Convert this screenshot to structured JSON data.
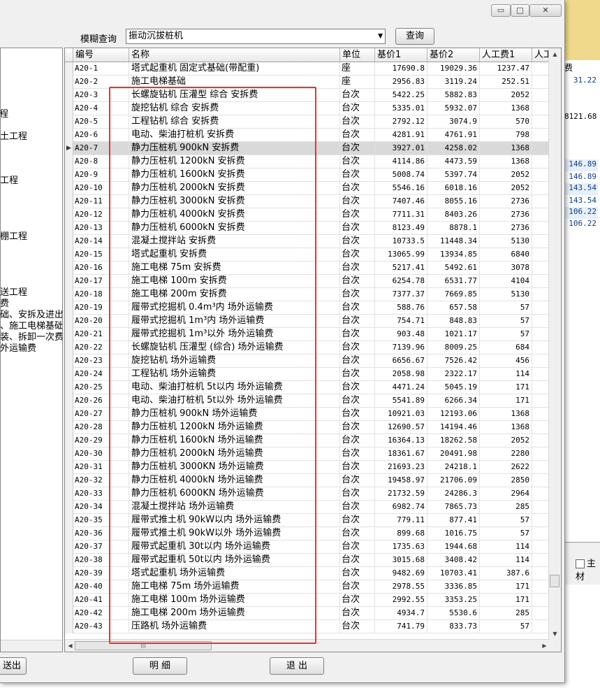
{
  "window": {
    "minimize_glyph": "▭",
    "maximize_glyph": "□",
    "close_glyph": "✕"
  },
  "search": {
    "label": "模糊查询",
    "value": "振动沉拔桩机",
    "dropdown_glyph": "▼",
    "query_button": "查询"
  },
  "left_tree": [
    "程",
    "土工程",
    "工程",
    "棚工程",
    "送工程",
    "费",
    "础、安拆及进出",
    "、施工电梯基础",
    "装、拆卸一次费",
    "外运输费"
  ],
  "table": {
    "headers": [
      "编号",
      "名称",
      "单位",
      "基价1",
      "基价2",
      "人工费1",
      "人工"
    ],
    "selected_marker": "▶",
    "rows": [
      {
        "code": "A20-1",
        "name": "塔式起重机 固定式基础(带配重)",
        "unit": "座",
        "p1": "17690.8",
        "p2": "19029.36",
        "lab": "1237.47"
      },
      {
        "code": "A20-2",
        "name": "施工电梯基础",
        "unit": "座",
        "p1": "2956.83",
        "p2": "3119.24",
        "lab": "252.51"
      },
      {
        "code": "A20-3",
        "name": "长螺旋钻机 压灌型 综合 安拆费",
        "unit": "台次",
        "p1": "5422.25",
        "p2": "5882.83",
        "lab": "2052"
      },
      {
        "code": "A20-4",
        "name": "旋挖钻机 综合 安拆费",
        "unit": "台次",
        "p1": "5335.01",
        "p2": "5932.07",
        "lab": "1368"
      },
      {
        "code": "A20-5",
        "name": "工程钻机 综合 安拆费",
        "unit": "台次",
        "p1": "2792.12",
        "p2": "3074.9",
        "lab": "570"
      },
      {
        "code": "A20-6",
        "name": "电动、柴油打桩机 安拆费",
        "unit": "台次",
        "p1": "4281.91",
        "p2": "4761.91",
        "lab": "798"
      },
      {
        "code": "A20-7",
        "name": "静力压桩机 900kN 安拆费",
        "unit": "台次",
        "p1": "3927.01",
        "p2": "4258.02",
        "lab": "1368"
      },
      {
        "code": "A20-8",
        "name": "静力压桩机 1200kN 安拆费",
        "unit": "台次",
        "p1": "4114.86",
        "p2": "4473.59",
        "lab": "1368"
      },
      {
        "code": "A20-9",
        "name": "静力压桩机 1600kN 安拆费",
        "unit": "台次",
        "p1": "5008.74",
        "p2": "5397.74",
        "lab": "2052"
      },
      {
        "code": "A20-10",
        "name": "静力压桩机 2000kN 安拆费",
        "unit": "台次",
        "p1": "5546.16",
        "p2": "6018.16",
        "lab": "2052"
      },
      {
        "code": "A20-11",
        "name": "静力压桩机 3000kN 安拆费",
        "unit": "台次",
        "p1": "7407.46",
        "p2": "8055.16",
        "lab": "2736"
      },
      {
        "code": "A20-12",
        "name": "静力压桩机 4000kN 安拆费",
        "unit": "台次",
        "p1": "7711.31",
        "p2": "8403.26",
        "lab": "2736"
      },
      {
        "code": "A20-13",
        "name": "静力压桩机 6000kN 安拆费",
        "unit": "台次",
        "p1": "8123.49",
        "p2": "8878.1",
        "lab": "2736"
      },
      {
        "code": "A20-14",
        "name": "混凝土搅拌站 安拆费",
        "unit": "台次",
        "p1": "10733.5",
        "p2": "11448.34",
        "lab": "5130"
      },
      {
        "code": "A20-15",
        "name": "塔式起重机 安拆费",
        "unit": "台次",
        "p1": "13065.99",
        "p2": "13934.85",
        "lab": "6840"
      },
      {
        "code": "A20-16",
        "name": "施工电梯 75m 安拆费",
        "unit": "台次",
        "p1": "5217.41",
        "p2": "5492.61",
        "lab": "3078"
      },
      {
        "code": "A20-17",
        "name": "施工电梯 100m 安拆费",
        "unit": "台次",
        "p1": "6254.78",
        "p2": "6531.77",
        "lab": "4104"
      },
      {
        "code": "A20-18",
        "name": "施工电梯 200m 安拆费",
        "unit": "台次",
        "p1": "7377.37",
        "p2": "7669.85",
        "lab": "5130"
      },
      {
        "code": "A20-19",
        "name": "履带式挖掘机 0.4m³内 场外运输费",
        "unit": "台次",
        "p1": "588.76",
        "p2": "657.58",
        "lab": "57"
      },
      {
        "code": "A20-20",
        "name": "履带式挖掘机 1m³内 场外运输费",
        "unit": "台次",
        "p1": "754.71",
        "p2": "848.83",
        "lab": "57"
      },
      {
        "code": "A20-21",
        "name": "履带式挖掘机 1m³以外 场外运输费",
        "unit": "台次",
        "p1": "903.48",
        "p2": "1021.17",
        "lab": "57"
      },
      {
        "code": "A20-22",
        "name": "长螺旋钻机 压灌型 (综合) 场外运输费",
        "unit": "台次",
        "p1": "7139.96",
        "p2": "8009.25",
        "lab": "684"
      },
      {
        "code": "A20-23",
        "name": "旋挖钻机 场外运输费",
        "unit": "台次",
        "p1": "6656.67",
        "p2": "7526.42",
        "lab": "456"
      },
      {
        "code": "A20-24",
        "name": "工程钻机 场外运输费",
        "unit": "台次",
        "p1": "2058.98",
        "p2": "2322.17",
        "lab": "114"
      },
      {
        "code": "A20-25",
        "name": "电动、柴油打桩机 5t以内 场外运输费",
        "unit": "台次",
        "p1": "4471.24",
        "p2": "5045.19",
        "lab": "171"
      },
      {
        "code": "A20-26",
        "name": "电动、柴油打桩机 5t以外 场外运输费",
        "unit": "台次",
        "p1": "5541.89",
        "p2": "6266.34",
        "lab": "171"
      },
      {
        "code": "A20-27",
        "name": "静力压桩机 900kN 场外运输费",
        "unit": "台次",
        "p1": "10921.03",
        "p2": "12193.06",
        "lab": "1368"
      },
      {
        "code": "A20-28",
        "name": "静力压桩机 1200kN 场外运输费",
        "unit": "台次",
        "p1": "12690.57",
        "p2": "14194.46",
        "lab": "1368"
      },
      {
        "code": "A20-29",
        "name": "静力压桩机 1600kN 场外运输费",
        "unit": "台次",
        "p1": "16364.13",
        "p2": "18262.58",
        "lab": "2052"
      },
      {
        "code": "A20-30",
        "name": "静力压桩机 2000kN 场外运输费",
        "unit": "台次",
        "p1": "18361.67",
        "p2": "20491.98",
        "lab": "2280"
      },
      {
        "code": "A20-31",
        "name": "静力压桩机 3000KN 场外运输费",
        "unit": "台次",
        "p1": "21693.23",
        "p2": "24218.1",
        "lab": "2622"
      },
      {
        "code": "A20-32",
        "name": "静力压桩机 4000kN 场外运输费",
        "unit": "台次",
        "p1": "19458.97",
        "p2": "21706.09",
        "lab": "2850"
      },
      {
        "code": "A20-33",
        "name": "静力压桩机 6000KN 场外运输费",
        "unit": "台次",
        "p1": "21732.59",
        "p2": "24286.3",
        "lab": "2964"
      },
      {
        "code": "A20-34",
        "name": "混凝土搅拌站 场外运输费",
        "unit": "台次",
        "p1": "6982.74",
        "p2": "7865.73",
        "lab": "285"
      },
      {
        "code": "A20-35",
        "name": "履带式推土机 90kW以内 场外运输费",
        "unit": "台次",
        "p1": "779.11",
        "p2": "877.41",
        "lab": "57"
      },
      {
        "code": "A20-36",
        "name": "履带式推土机 90kW以外 场外运输费",
        "unit": "台次",
        "p1": "899.68",
        "p2": "1016.75",
        "lab": "57"
      },
      {
        "code": "A20-37",
        "name": "履带式起重机 30t以内 场外运输费",
        "unit": "台次",
        "p1": "1735.63",
        "p2": "1944.68",
        "lab": "114"
      },
      {
        "code": "A20-38",
        "name": "履带式起重机 50t以内 场外运输费",
        "unit": "台次",
        "p1": "3015.68",
        "p2": "3408.42",
        "lab": "114"
      },
      {
        "code": "A20-39",
        "name": "塔式起重机 场外运输费",
        "unit": "台次",
        "p1": "9482.69",
        "p2": "10703.41",
        "lab": "387.6"
      },
      {
        "code": "A20-40",
        "name": "施工电梯 75m 场外运输费",
        "unit": "台次",
        "p1": "2978.55",
        "p2": "3336.85",
        "lab": "171"
      },
      {
        "code": "A20-41",
        "name": "施工电梯 100m 场外运输费",
        "unit": "台次",
        "p1": "2992.55",
        "p2": "3353.25",
        "lab": "171"
      },
      {
        "code": "A20-42",
        "name": "施工电梯 200m 场外运输费",
        "unit": "台次",
        "p1": "4934.7",
        "p2": "5530.6",
        "lab": "285"
      },
      {
        "code": "A20-43",
        "name": "压路机 场外运输费",
        "unit": "台次",
        "p1": "741.79",
        "p2": "833.73",
        "lab": "57"
      }
    ]
  },
  "footer": {
    "left_button": "送出",
    "detail_button": "明 细",
    "exit_button": "退 出"
  },
  "background_window": {
    "header_fragment": "费",
    "values": [
      "31.22",
      "8121.68",
      "146.89",
      "146.89",
      "143.54",
      "143.54",
      "106.22",
      "106.22"
    ],
    "checkbox_label": "主材"
  },
  "icons": {
    "scroll_up": "▲",
    "scroll_down": "▼",
    "scroll_left": "◀",
    "scroll_right": "▶",
    "thumb_grip": "|||"
  }
}
